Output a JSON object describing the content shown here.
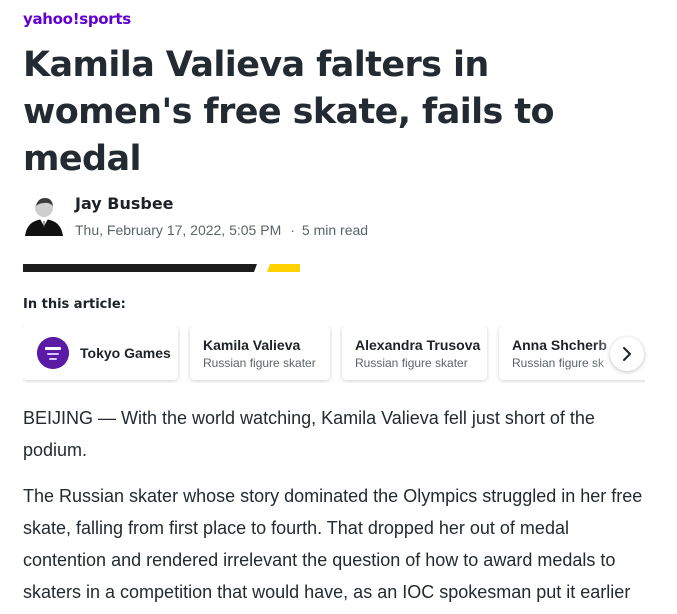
{
  "brand": {
    "logo_text": "yahoo!",
    "logo_section": "sports",
    "color": "#6001d2"
  },
  "article": {
    "headline": "Kamila Valieva falters in women's free skate, fails to medal",
    "author": "Jay Busbee",
    "date": "Thu, February 17, 2022, 5:05 PM",
    "read_time": "5 min read",
    "paragraphs": [
      "BEIJING — With the world watching, Kamila Valieva fell just short of the podium.",
      "The Russian skater whose story dominated the Olympics struggled in her free skate, falling from first place to fourth. That dropped her out of medal contention and rendered irrelevant the question of how to award medals to skaters in a competition that would have, as an IOC spokesman put it earlier"
    ]
  },
  "in_this_article": {
    "label": "In this article:",
    "chips": [
      {
        "name": "Tokyo Games",
        "sub": "",
        "icon": "tokyo-games-logo"
      },
      {
        "name": "Kamila Valieva",
        "sub": "Russian figure skater"
      },
      {
        "name": "Alexandra Trusova",
        "sub": "Russian figure skater"
      },
      {
        "name": "Anna Shcherb",
        "sub": "Russian figure sk"
      }
    ],
    "next_icon": "chevron-right-icon"
  },
  "colors": {
    "text": "#232a31",
    "muted": "#5b636a",
    "accent_yellow": "#ffd100",
    "bar_black": "#1d1d1d"
  }
}
